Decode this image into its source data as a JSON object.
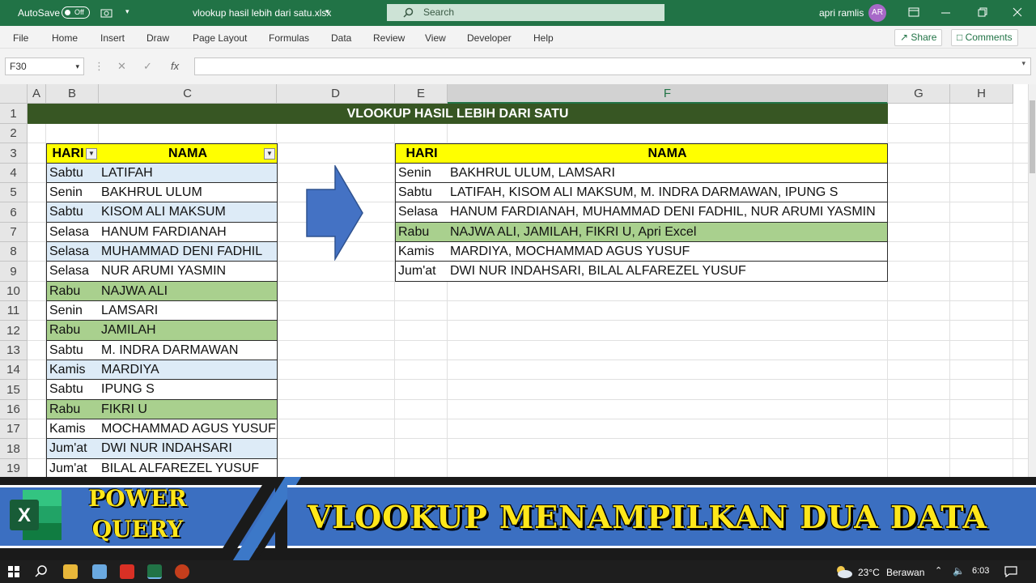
{
  "titlebar": {
    "autosave": "AutoSave",
    "toggle": "Off",
    "filename": "vlookup hasil lebih dari satu.xlsx",
    "search": "Search",
    "user": "apri ramlis",
    "avatar": "AR"
  },
  "ribbon": {
    "tabs": [
      "File",
      "Home",
      "Insert",
      "Draw",
      "Page Layout",
      "Formulas",
      "Data",
      "Review",
      "View",
      "Developer",
      "Help"
    ],
    "share": "Share",
    "comments": "Comments"
  },
  "formula_bar": {
    "namebox": "F30",
    "fx": "fx",
    "value": ""
  },
  "grid": {
    "columns": [
      "A",
      "B",
      "C",
      "D",
      "E",
      "F",
      "G",
      "H"
    ],
    "rows": [
      "1",
      "2",
      "3",
      "4",
      "5",
      "6",
      "7",
      "8",
      "9",
      "10",
      "11",
      "12",
      "13",
      "14",
      "15",
      "16",
      "17",
      "18",
      "19"
    ],
    "selected_column": "F",
    "banner": "VLOOKUP HASIL LEBIH DARI SATU"
  },
  "left_table": {
    "headers": [
      "HARI",
      "NAMA"
    ],
    "rows": [
      [
        "Sabtu",
        "LATIFAH"
      ],
      [
        "Senin",
        "BAKHRUL ULUM"
      ],
      [
        "Sabtu",
        "KISOM ALI MAKSUM"
      ],
      [
        "Selasa",
        "HANUM FARDIANAH"
      ],
      [
        "Selasa",
        "MUHAMMAD DENI FADHIL"
      ],
      [
        "Selasa",
        "NUR ARUMI YASMIN"
      ],
      [
        "Rabu",
        "NAJWA ALI"
      ],
      [
        "Senin",
        "LAMSARI"
      ],
      [
        "Rabu",
        "JAMILAH"
      ],
      [
        "Sabtu",
        "M. INDRA DARMAWAN"
      ],
      [
        "Kamis",
        "MARDIYA"
      ],
      [
        "Sabtu",
        "IPUNG S"
      ],
      [
        "Rabu",
        "FIKRI U"
      ],
      [
        "Kamis",
        "MOCHAMMAD AGUS YUSUF"
      ],
      [
        "Jum'at",
        "DWI NUR INDAHSARI"
      ],
      [
        "Jum'at",
        "BILAL ALFAREZEL YUSUF"
      ]
    ]
  },
  "right_table": {
    "headers": [
      "HARI",
      "NAMA"
    ],
    "rows": [
      [
        "Senin",
        "BAKHRUL ULUM, LAMSARI"
      ],
      [
        "Sabtu",
        "LATIFAH, KISOM ALI MAKSUM, M. INDRA DARMAWAN, IPUNG S"
      ],
      [
        "Selasa",
        "HANUM FARDIANAH, MUHAMMAD DENI FADHIL, NUR ARUMI YASMIN"
      ],
      [
        "Rabu",
        "NAJWA ALI, JAMILAH, FIKRI U, Apri Excel"
      ],
      [
        "Kamis",
        "MARDIYA, MOCHAMMAD AGUS YUSUF"
      ],
      [
        "Jum'at",
        "DWI NUR INDAHSARI, BILAL ALFAREZEL YUSUF"
      ]
    ]
  },
  "overlay": {
    "left_line1": "POWER",
    "left_line2": "QUERY",
    "title": "VLOOKUP MENAMPILKAN DUA DATA",
    "logo_letter": "X"
  },
  "taskbar": {
    "weather": "23°C",
    "weather_desc": "Berawan",
    "time": "6:03"
  },
  "colors": {
    "excel_green": "#217346",
    "banner_green": "#375623",
    "header_yellow": "#ffff00",
    "row_blue": "#ddebf7",
    "row_green": "#a9d08e",
    "arrow_blue": "#4472c4"
  }
}
